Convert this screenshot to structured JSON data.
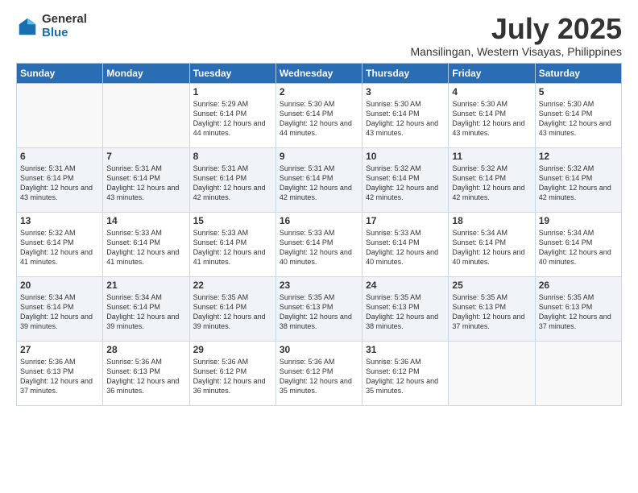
{
  "logo": {
    "general": "General",
    "blue": "Blue"
  },
  "header": {
    "month": "July 2025",
    "location": "Mansilingan, Western Visayas, Philippines"
  },
  "days_of_week": [
    "Sunday",
    "Monday",
    "Tuesday",
    "Wednesday",
    "Thursday",
    "Friday",
    "Saturday"
  ],
  "weeks": [
    [
      {
        "day": null
      },
      {
        "day": null
      },
      {
        "day": "1",
        "sunrise": "5:29 AM",
        "sunset": "6:14 PM",
        "daylight": "12 hours and 44 minutes."
      },
      {
        "day": "2",
        "sunrise": "5:30 AM",
        "sunset": "6:14 PM",
        "daylight": "12 hours and 44 minutes."
      },
      {
        "day": "3",
        "sunrise": "5:30 AM",
        "sunset": "6:14 PM",
        "daylight": "12 hours and 43 minutes."
      },
      {
        "day": "4",
        "sunrise": "5:30 AM",
        "sunset": "6:14 PM",
        "daylight": "12 hours and 43 minutes."
      },
      {
        "day": "5",
        "sunrise": "5:30 AM",
        "sunset": "6:14 PM",
        "daylight": "12 hours and 43 minutes."
      }
    ],
    [
      {
        "day": "6",
        "sunrise": "5:31 AM",
        "sunset": "6:14 PM",
        "daylight": "12 hours and 43 minutes."
      },
      {
        "day": "7",
        "sunrise": "5:31 AM",
        "sunset": "6:14 PM",
        "daylight": "12 hours and 43 minutes."
      },
      {
        "day": "8",
        "sunrise": "5:31 AM",
        "sunset": "6:14 PM",
        "daylight": "12 hours and 42 minutes."
      },
      {
        "day": "9",
        "sunrise": "5:31 AM",
        "sunset": "6:14 PM",
        "daylight": "12 hours and 42 minutes."
      },
      {
        "day": "10",
        "sunrise": "5:32 AM",
        "sunset": "6:14 PM",
        "daylight": "12 hours and 42 minutes."
      },
      {
        "day": "11",
        "sunrise": "5:32 AM",
        "sunset": "6:14 PM",
        "daylight": "12 hours and 42 minutes."
      },
      {
        "day": "12",
        "sunrise": "5:32 AM",
        "sunset": "6:14 PM",
        "daylight": "12 hours and 42 minutes."
      }
    ],
    [
      {
        "day": "13",
        "sunrise": "5:32 AM",
        "sunset": "6:14 PM",
        "daylight": "12 hours and 41 minutes."
      },
      {
        "day": "14",
        "sunrise": "5:33 AM",
        "sunset": "6:14 PM",
        "daylight": "12 hours and 41 minutes."
      },
      {
        "day": "15",
        "sunrise": "5:33 AM",
        "sunset": "6:14 PM",
        "daylight": "12 hours and 41 minutes."
      },
      {
        "day": "16",
        "sunrise": "5:33 AM",
        "sunset": "6:14 PM",
        "daylight": "12 hours and 40 minutes."
      },
      {
        "day": "17",
        "sunrise": "5:33 AM",
        "sunset": "6:14 PM",
        "daylight": "12 hours and 40 minutes."
      },
      {
        "day": "18",
        "sunrise": "5:34 AM",
        "sunset": "6:14 PM",
        "daylight": "12 hours and 40 minutes."
      },
      {
        "day": "19",
        "sunrise": "5:34 AM",
        "sunset": "6:14 PM",
        "daylight": "12 hours and 40 minutes."
      }
    ],
    [
      {
        "day": "20",
        "sunrise": "5:34 AM",
        "sunset": "6:14 PM",
        "daylight": "12 hours and 39 minutes."
      },
      {
        "day": "21",
        "sunrise": "5:34 AM",
        "sunset": "6:14 PM",
        "daylight": "12 hours and 39 minutes."
      },
      {
        "day": "22",
        "sunrise": "5:35 AM",
        "sunset": "6:14 PM",
        "daylight": "12 hours and 39 minutes."
      },
      {
        "day": "23",
        "sunrise": "5:35 AM",
        "sunset": "6:13 PM",
        "daylight": "12 hours and 38 minutes."
      },
      {
        "day": "24",
        "sunrise": "5:35 AM",
        "sunset": "6:13 PM",
        "daylight": "12 hours and 38 minutes."
      },
      {
        "day": "25",
        "sunrise": "5:35 AM",
        "sunset": "6:13 PM",
        "daylight": "12 hours and 37 minutes."
      },
      {
        "day": "26",
        "sunrise": "5:35 AM",
        "sunset": "6:13 PM",
        "daylight": "12 hours and 37 minutes."
      }
    ],
    [
      {
        "day": "27",
        "sunrise": "5:36 AM",
        "sunset": "6:13 PM",
        "daylight": "12 hours and 37 minutes."
      },
      {
        "day": "28",
        "sunrise": "5:36 AM",
        "sunset": "6:13 PM",
        "daylight": "12 hours and 36 minutes."
      },
      {
        "day": "29",
        "sunrise": "5:36 AM",
        "sunset": "6:12 PM",
        "daylight": "12 hours and 36 minutes."
      },
      {
        "day": "30",
        "sunrise": "5:36 AM",
        "sunset": "6:12 PM",
        "daylight": "12 hours and 35 minutes."
      },
      {
        "day": "31",
        "sunrise": "5:36 AM",
        "sunset": "6:12 PM",
        "daylight": "12 hours and 35 minutes."
      },
      {
        "day": null
      },
      {
        "day": null
      }
    ]
  ],
  "labels": {
    "sunrise_prefix": "Sunrise:",
    "sunset_prefix": "Sunset:",
    "daylight_prefix": "Daylight:"
  }
}
